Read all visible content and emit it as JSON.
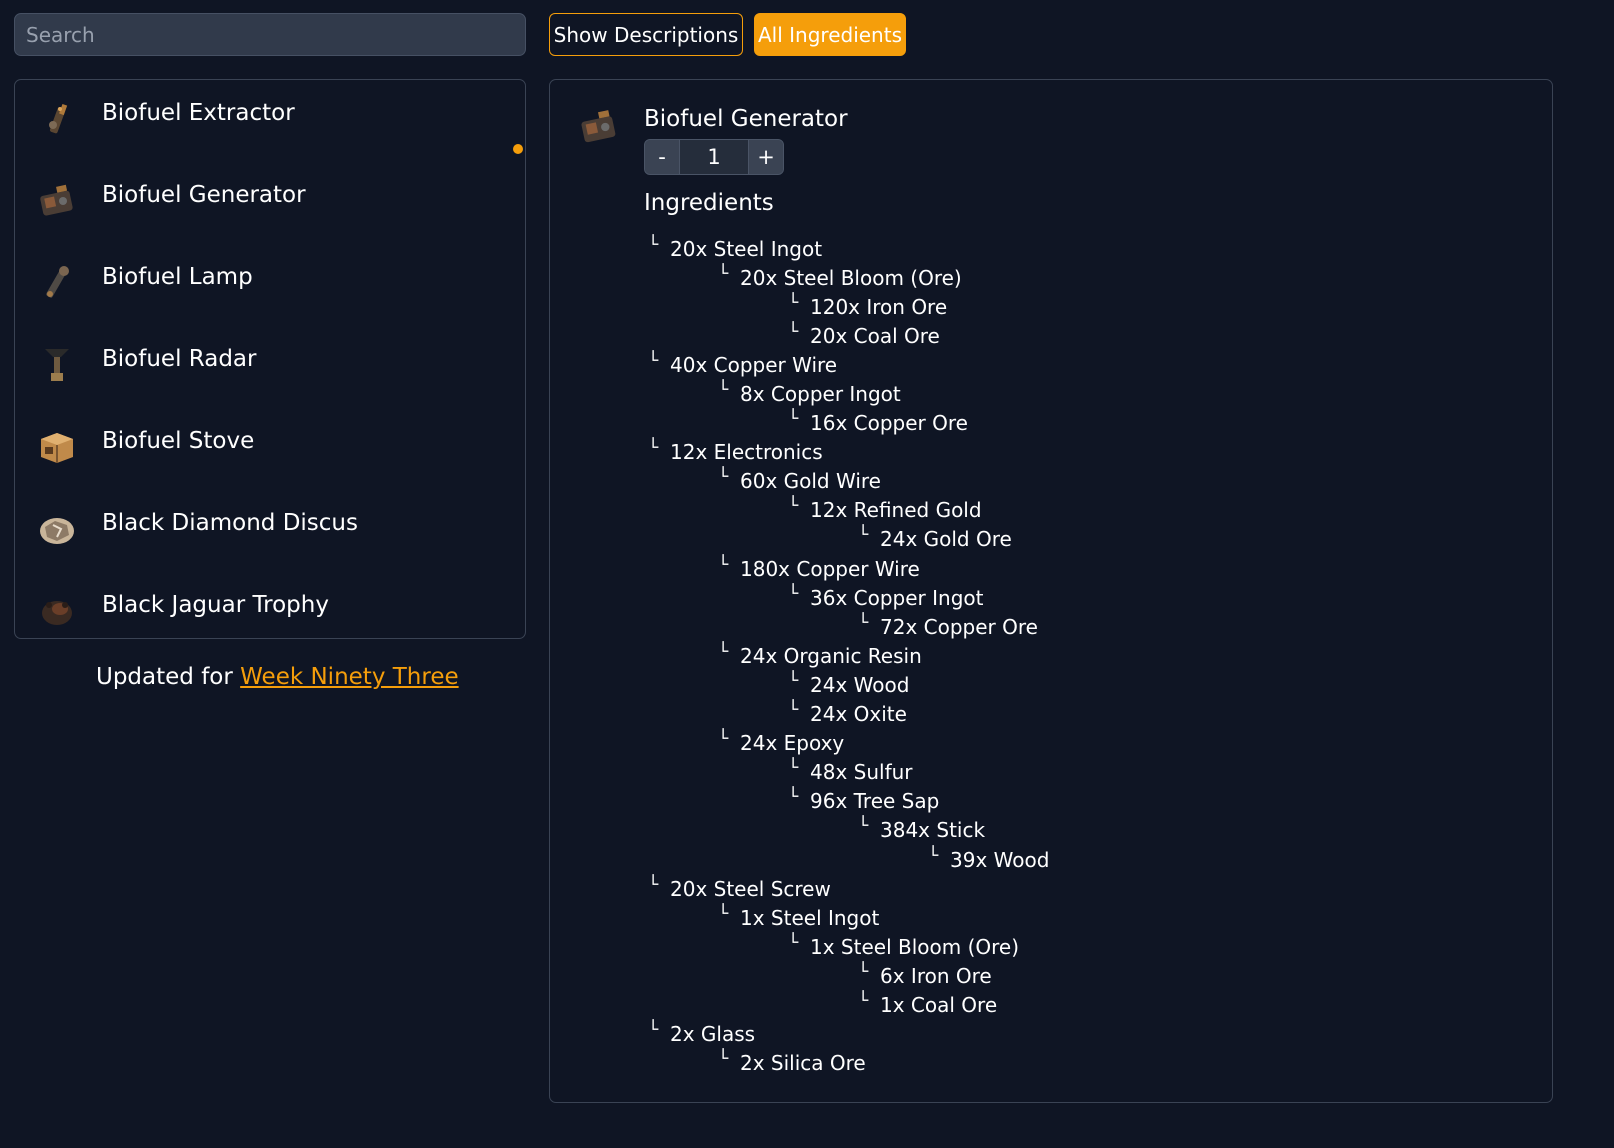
{
  "search": {
    "placeholder": "Search",
    "value": ""
  },
  "toolbar": {
    "show_descriptions_label": "Show Descriptions",
    "all_ingredients_label": "All Ingredients"
  },
  "colors": {
    "background": "#0f1524",
    "accent": "#f59e0b",
    "border": "#3a4354"
  },
  "item_list": [
    {
      "label": "Biofuel Extractor",
      "icon": "biofuel-extractor-icon"
    },
    {
      "label": "Biofuel Generator",
      "icon": "biofuel-generator-icon"
    },
    {
      "label": "Biofuel Lamp",
      "icon": "biofuel-lamp-icon"
    },
    {
      "label": "Biofuel Radar",
      "icon": "biofuel-radar-icon"
    },
    {
      "label": "Biofuel Stove",
      "icon": "biofuel-stove-icon"
    },
    {
      "label": "Black Diamond Discus",
      "icon": "black-diamond-discus-icon"
    },
    {
      "label": "Black Jaguar Trophy",
      "icon": "black-jaguar-trophy-icon"
    }
  ],
  "footer": {
    "prefix": "Updated for ",
    "link_text": "Week Ninety Three"
  },
  "detail": {
    "title": "Biofuel Generator",
    "icon": "biofuel-generator-icon",
    "quantity": "1",
    "decrement_label": "-",
    "increment_label": "+",
    "ingredients_heading": "Ingredients",
    "tree_marker": "└",
    "ingredients": [
      {
        "depth": 0,
        "text": "20x Steel Ingot"
      },
      {
        "depth": 1,
        "text": "20x Steel Bloom (Ore)"
      },
      {
        "depth": 2,
        "text": "120x Iron Ore"
      },
      {
        "depth": 2,
        "text": "20x Coal Ore"
      },
      {
        "depth": 0,
        "text": "40x Copper Wire"
      },
      {
        "depth": 1,
        "text": "8x Copper Ingot"
      },
      {
        "depth": 2,
        "text": "16x Copper Ore"
      },
      {
        "depth": 0,
        "text": "12x Electronics"
      },
      {
        "depth": 1,
        "text": "60x Gold Wire"
      },
      {
        "depth": 2,
        "text": "12x Refined Gold"
      },
      {
        "depth": 3,
        "text": "24x Gold Ore"
      },
      {
        "depth": 1,
        "text": "180x Copper Wire"
      },
      {
        "depth": 2,
        "text": "36x Copper Ingot"
      },
      {
        "depth": 3,
        "text": "72x Copper Ore"
      },
      {
        "depth": 1,
        "text": "24x Organic Resin"
      },
      {
        "depth": 2,
        "text": "24x Wood"
      },
      {
        "depth": 2,
        "text": "24x Oxite"
      },
      {
        "depth": 1,
        "text": "24x Epoxy"
      },
      {
        "depth": 2,
        "text": "48x Sulfur"
      },
      {
        "depth": 2,
        "text": "96x Tree Sap"
      },
      {
        "depth": 3,
        "text": "384x Stick"
      },
      {
        "depth": 4,
        "text": "39x Wood"
      },
      {
        "depth": 0,
        "text": "20x Steel Screw"
      },
      {
        "depth": 1,
        "text": "1x Steel Ingot"
      },
      {
        "depth": 2,
        "text": "1x Steel Bloom (Ore)"
      },
      {
        "depth": 3,
        "text": "6x Iron Ore"
      },
      {
        "depth": 3,
        "text": "1x Coal Ore"
      },
      {
        "depth": 0,
        "text": "2x Glass"
      },
      {
        "depth": 1,
        "text": "2x Silica Ore"
      }
    ]
  }
}
